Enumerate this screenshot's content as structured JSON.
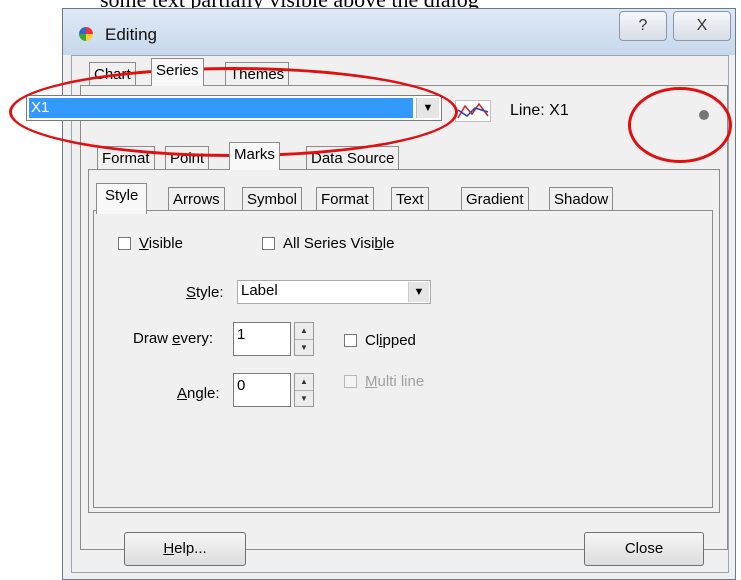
{
  "background_text": "some text partially visible above the dialog",
  "window": {
    "title": "Editing",
    "help_glyph": "?",
    "close_glyph": "X"
  },
  "main_tabs": [
    {
      "label": "Chart",
      "active": false
    },
    {
      "label": "Series",
      "active": true
    },
    {
      "label": "Themes",
      "active": false
    }
  ],
  "series_select": {
    "value": "X1",
    "arrow": "▼",
    "type_label": "Line: X1",
    "icon": "line-series-icon"
  },
  "series_tabs": [
    {
      "label": "Format",
      "active": false
    },
    {
      "label": "Point",
      "active": false
    },
    {
      "label": "Marks",
      "active": true
    },
    {
      "label": "Data Source",
      "active": false
    }
  ],
  "marks_tabs": [
    {
      "label": "Style",
      "active": true
    },
    {
      "label": "Arrows",
      "active": false
    },
    {
      "label": "Symbol",
      "active": false
    },
    {
      "label": "Format",
      "active": false
    },
    {
      "label": "Text",
      "active": false
    },
    {
      "label": "Gradient",
      "active": false
    },
    {
      "label": "Shadow",
      "active": false
    }
  ],
  "style_page": {
    "visible": {
      "label_key": "V",
      "label_rest": "isible",
      "checked": false
    },
    "all_series_visible": {
      "label_pre": "All Series Visi",
      "label_key": "b",
      "label_post": "le",
      "checked": false
    },
    "style": {
      "label_key": "S",
      "label_rest": "tyle:",
      "value": "Label"
    },
    "draw_every": {
      "label_pre": "Draw ",
      "label_key": "e",
      "label_post": "very:",
      "value": "1"
    },
    "clipped": {
      "label_pre": "Cl",
      "label_key": "i",
      "label_post": "pped",
      "checked": false
    },
    "angle": {
      "label_key": "A",
      "label_rest": "ngle:",
      "value": "0"
    },
    "multi_line": {
      "label_key": "M",
      "label_rest": "ulti line",
      "checked": false,
      "enabled": false
    }
  },
  "footer": {
    "help": {
      "label_key": "H",
      "label_rest": "elp..."
    },
    "close": "Close"
  },
  "colors": {
    "selection": "#3399ff",
    "annotation": "#e01010",
    "dialog_bg": "#f0f0f0"
  }
}
